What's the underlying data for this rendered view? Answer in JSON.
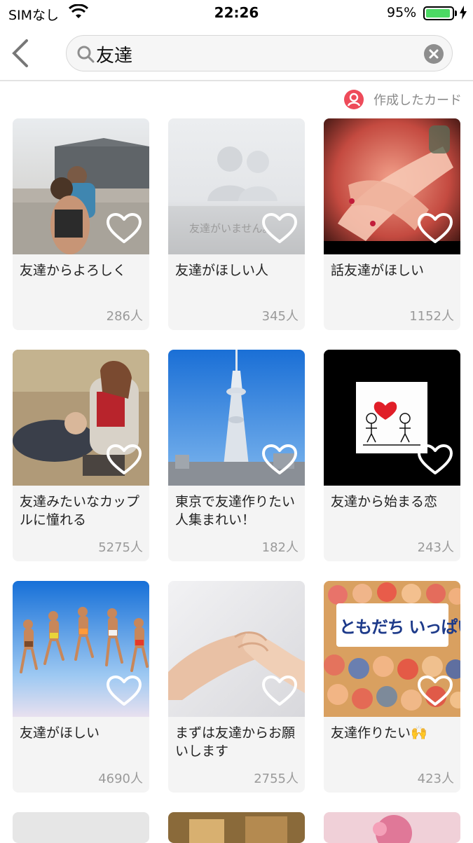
{
  "status_bar": {
    "carrier": "SIMなし",
    "time": "22:26",
    "battery": "95%",
    "battery_level": 0.95
  },
  "search": {
    "value": "友達"
  },
  "filter": {
    "label": "作成したカード"
  },
  "cards": [
    {
      "title": "友達からよろしく",
      "count": "286人",
      "image": "couple-selfie"
    },
    {
      "title": "友達がほしい人",
      "count": "345人",
      "image": "no-friends-placeholder",
      "image_text": "友達がいません。"
    },
    {
      "title": "話友達がほしい",
      "count": "1152人",
      "image": "holding-hands"
    },
    {
      "title": "友達みたいなカップルに憧れる",
      "count": "5275人",
      "image": "couple-lying"
    },
    {
      "title": "東京で友達作りたい人集まれい！",
      "count": "182人",
      "image": "skytree"
    },
    {
      "title": "友達から始まる恋",
      "count": "243人",
      "image": "heart-drawing"
    },
    {
      "title": "友達がほしい",
      "count": "4690人",
      "image": "jumping-friends"
    },
    {
      "title": "まずは友達からお願いします",
      "count": "2755人",
      "image": "hands-clasped"
    },
    {
      "title": "友達作りたい🙌",
      "count": "423人",
      "image": "tomodachi-book",
      "image_text": "ともだち いっぱい"
    }
  ],
  "colors": {
    "accent": "#ee4b5a",
    "battery": "#4cd964"
  }
}
